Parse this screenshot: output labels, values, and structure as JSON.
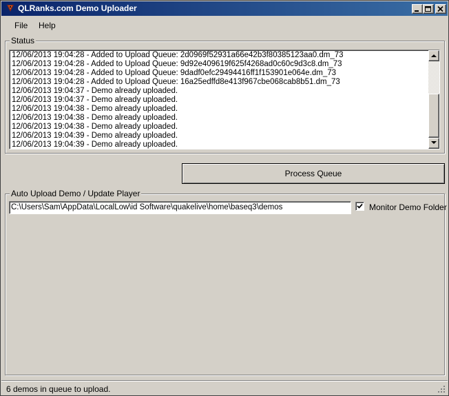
{
  "window": {
    "title": "QLRanks.com Demo Uploader"
  },
  "menu": {
    "file": "File",
    "help": "Help"
  },
  "status_group": {
    "label": "Status",
    "log": [
      "12/06/2013 19:04:28 - Added to Upload Queue: 2d0969f52931a66e42b3f80385123aa0.dm_73",
      "12/06/2013 19:04:28 - Added to Upload Queue: 9d92e409619f625f4268ad0c60c9d3c8.dm_73",
      "12/06/2013 19:04:28 - Added to Upload Queue: 9dadf0efc29494416ff1f153901e064e.dm_73",
      "12/06/2013 19:04:28 - Added to Upload Queue: 16a25edffd8e413f967cbe068cab8b51.dm_73",
      "12/06/2013 19:04:37 - Demo already uploaded.",
      "12/06/2013 19:04:37 - Demo already uploaded.",
      "12/06/2013 19:04:38 - Demo already uploaded.",
      "12/06/2013 19:04:38 - Demo already uploaded.",
      "12/06/2013 19:04:38 - Demo already uploaded.",
      "12/06/2013 19:04:39 - Demo already uploaded.",
      "12/06/2013 19:04:39 - Demo already uploaded."
    ]
  },
  "process_button": {
    "label": "Process Queue"
  },
  "auto_group": {
    "label": "Auto Upload Demo / Update Player",
    "path_value": "C:\\Users\\Sam\\AppData\\LocalLow\\id Software\\quakelive\\home\\baseq3\\demos",
    "monitor_label": "Monitor Demo Folder",
    "monitor_checked": true
  },
  "statusbar": {
    "text": "6 demos in queue to upload."
  },
  "colors": {
    "title_start": "#0a246a",
    "title_end": "#3a6ea5",
    "face": "#d4d0c8"
  },
  "icons": {
    "app": "quake-icon",
    "minimize": "minimize-icon",
    "maximize": "maximize-icon",
    "close": "close-icon"
  }
}
